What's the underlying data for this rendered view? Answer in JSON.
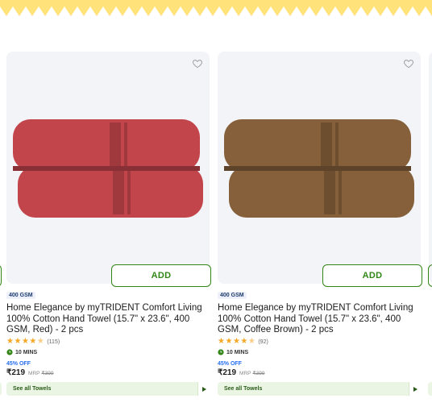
{
  "colors": {
    "banner": "#ffe27a",
    "brand_green": "#318616",
    "discount_blue": "#256fef",
    "star": "#f5a623"
  },
  "products": [
    {
      "variant": "400 GSM",
      "title": "Home Elegance by myTRIDENT Comfort Living 100% Cotton Hand Towel (15.7\" x 23.6\", 400 GSM, Red) - 2 pcs",
      "rating_stars": 4.5,
      "reviews": "(115)",
      "eta": "10 MINS",
      "discount": "45% OFF",
      "price": "₹219",
      "mrp_label": "MRP",
      "mrp": "₹399",
      "add_label": "ADD",
      "see_all": "See all Towels",
      "towel_color": "#c2454c"
    },
    {
      "variant": "400 GSM",
      "title": "Home Elegance by myTRIDENT Comfort Living 100% Cotton Hand Towel (15.7\" x 23.6\", 400 GSM, Coffee Brown) - 2 pcs",
      "rating_stars": 4.5,
      "reviews": "(92)",
      "eta": "10 MINS",
      "discount": "45% OFF",
      "price": "₹219",
      "mrp_label": "MRP",
      "mrp": "₹399",
      "add_label": "ADD",
      "see_all": "See all Towels",
      "towel_color": "#85603a"
    }
  ],
  "icons": {
    "heart": "heart-icon",
    "star": "star-icon",
    "clock": "clock-icon",
    "arrow": "chevron-right-icon"
  }
}
